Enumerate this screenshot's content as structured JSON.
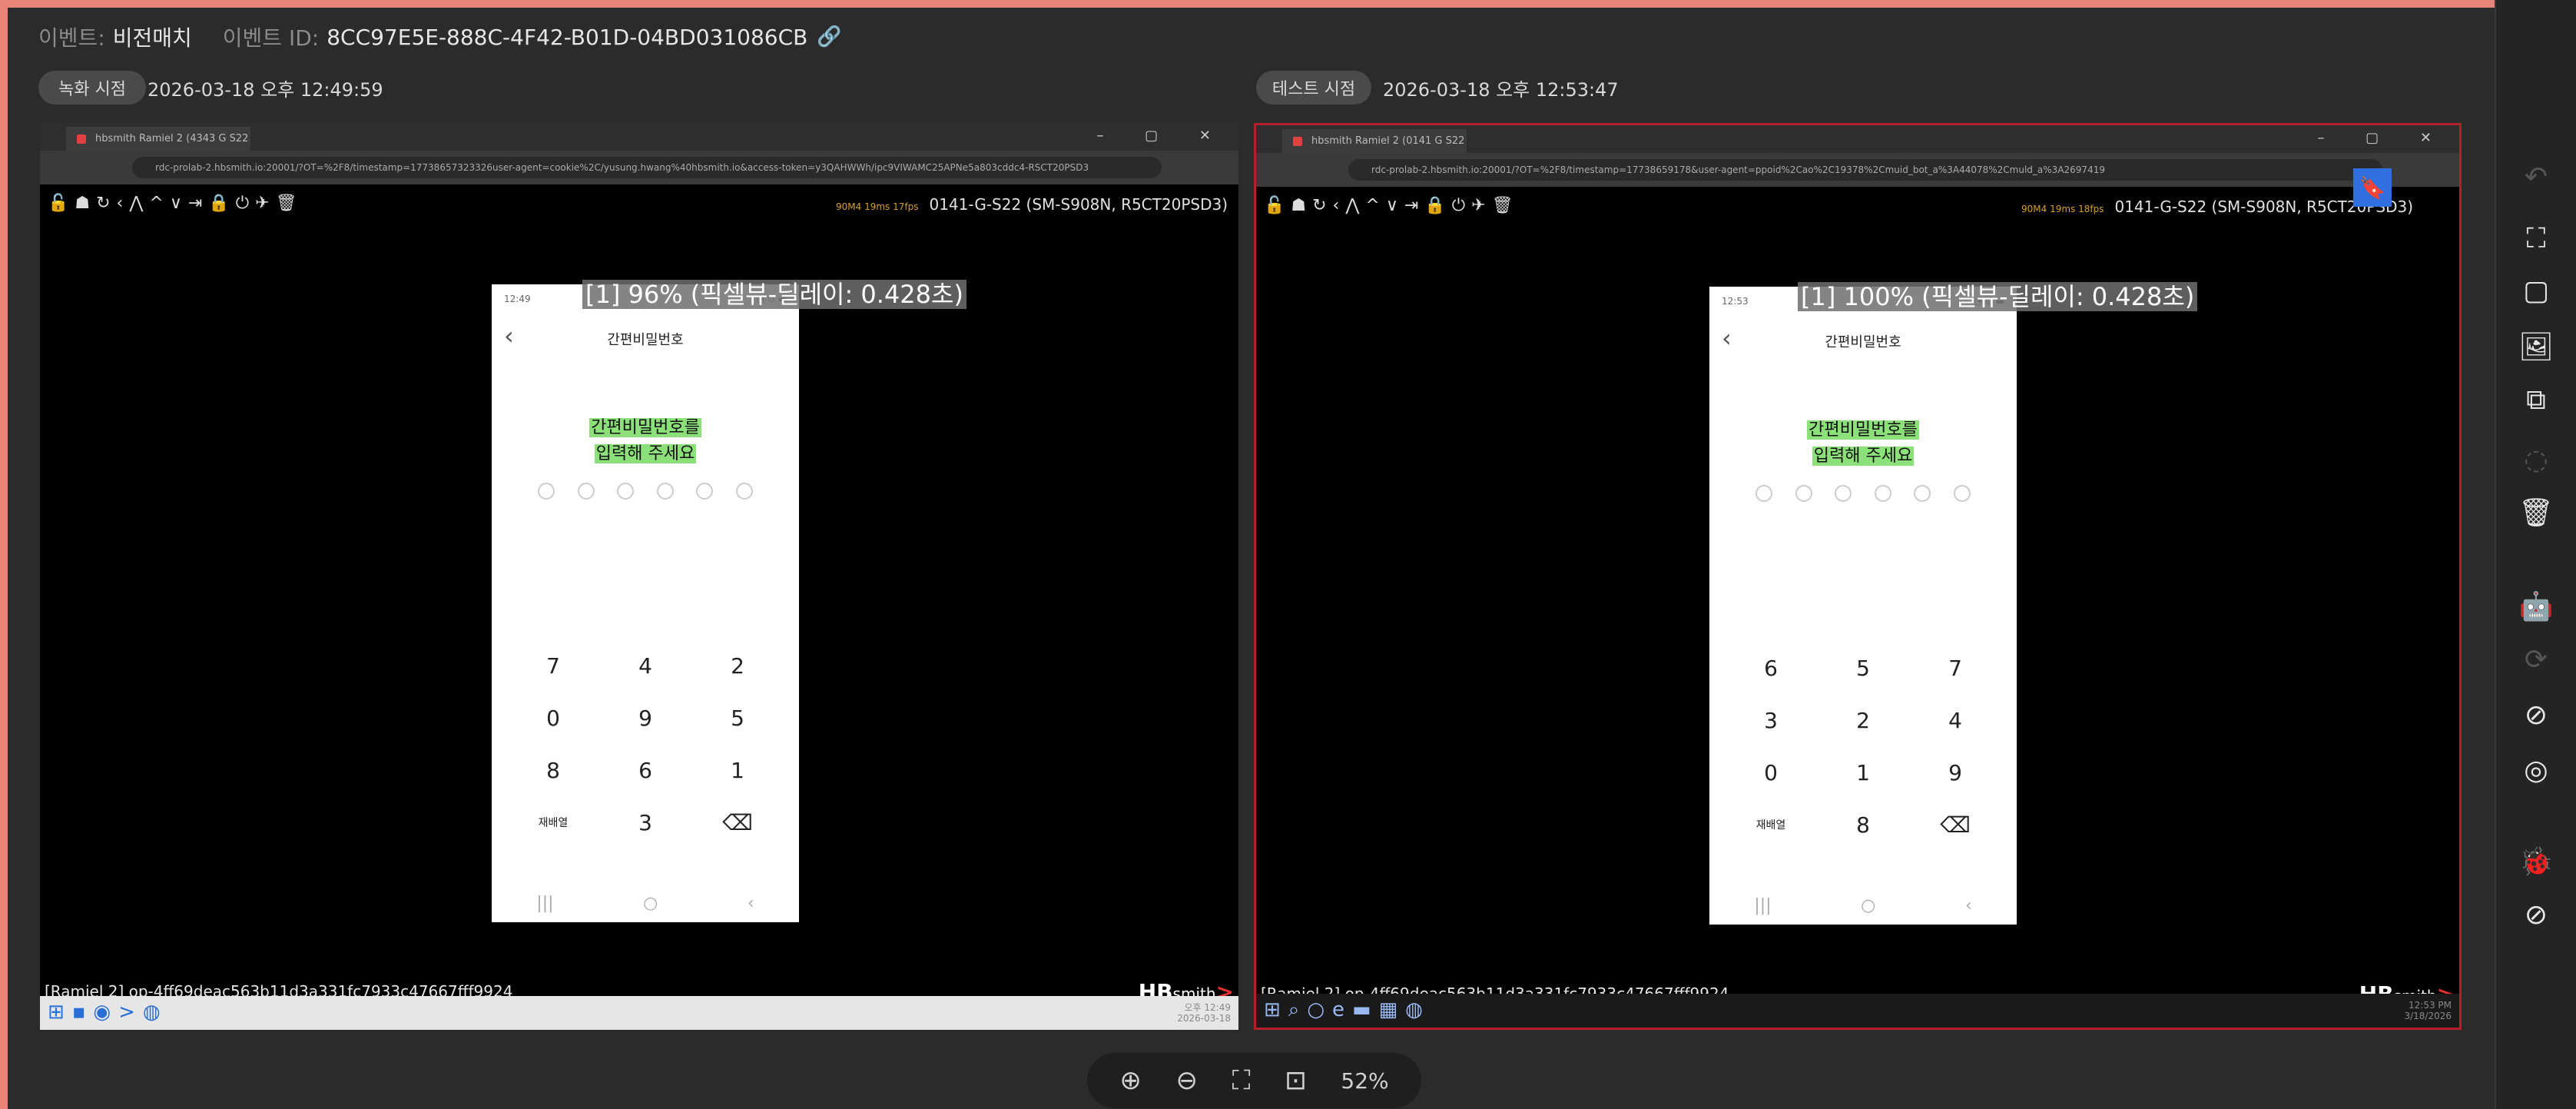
{
  "header": {
    "event_label": "이벤트:",
    "event_value": "비전매치",
    "event_id_label": "이벤트 ID:",
    "event_id_value": "8CC97E5E-888C-4F42-B01D-04BD031086CB"
  },
  "left": {
    "pill": "녹화 시점",
    "timestamp": "2026-03-18 오후 12:49:59",
    "tab_title": "hbsmith Ramiel 2 (4343 G S22",
    "url": "rdc-prolab-2.hbsmith.io:20001/?OT=%2F8/timestamp=17738657323326user-agent=cookie%2C/yusung.hwang%40hbsmith.io&access-token=y3QAHWWh/ipc9VIWAMC25APNe5a803cddc4-RSCT20PSD3",
    "device_label": "0141-G-S22 (SM-S908N, R5CT20PSD3)",
    "fps": "90M4  19ms  17fps",
    "phone_time": "12:49",
    "phone_title": "간편비밀번호",
    "prompt_line1": "간편비밀번호를",
    "prompt_line2": "입력해 주세요",
    "overlay": "[1] 96% (픽셀뷰-딜레이: 0.428초)",
    "keys": [
      "7",
      "4",
      "2",
      "0",
      "9",
      "5",
      "8",
      "6",
      "1",
      "재배열",
      "3",
      "⌫"
    ],
    "footer_id": "[Ramiel 2] op-4ff69deac563b11d3a331fc7933c47667fff9924",
    "brand": "HB",
    "brand_small": "smith",
    "tray": "오후 12:49\n2026-03-18"
  },
  "right": {
    "pill": "테스트 시점",
    "timestamp": "2026-03-18 오후 12:53:47",
    "tab_title": "hbsmith Ramiel 2 (0141 G S22",
    "url": "rdc-prolab-2.hbsmith.io:20001/?OT=%2F8/timestamp=17738659178&user-agent=ppoid%2Cao%2C19378%2Cmuid_bot_a%3A44078%2Cmuld_a%3A2697419",
    "device_label": "0141-G-S22 (SM-S908N, R5CT20PSD3)",
    "fps": "90M4  19ms  18fps",
    "phone_time": "12:53",
    "phone_title": "간편비밀번호",
    "prompt_line1": "간편비밀번호를",
    "prompt_line2": "입력해 주세요",
    "overlay": "[1] 100% (픽셀뷰-딜레이: 0.428초)",
    "keys": [
      "6",
      "5",
      "7",
      "3",
      "2",
      "4",
      "0",
      "1",
      "9",
      "재배열",
      "8",
      "⌫"
    ],
    "footer_id": "[Ramiel 2] op-4ff69deac563b11d3a331fc7933c47667fff9924",
    "brand": "HB",
    "brand_small": "smith",
    "tray": "12:53 PM\n3/18/2026"
  },
  "zoom": {
    "level": "52%"
  },
  "icons": {
    "link": "link-icon",
    "bookmark": "bookmark-icon",
    "fullscreen": "fullscreen-icon",
    "square": "square-icon",
    "image": "image-icon",
    "copy": "copy-icon",
    "trash": "trash-icon",
    "bot": "bot-icon",
    "location_off": "location-off-icon",
    "eye_off": "eye-off-icon",
    "bug": "bug-icon",
    "block": "block-icon"
  }
}
